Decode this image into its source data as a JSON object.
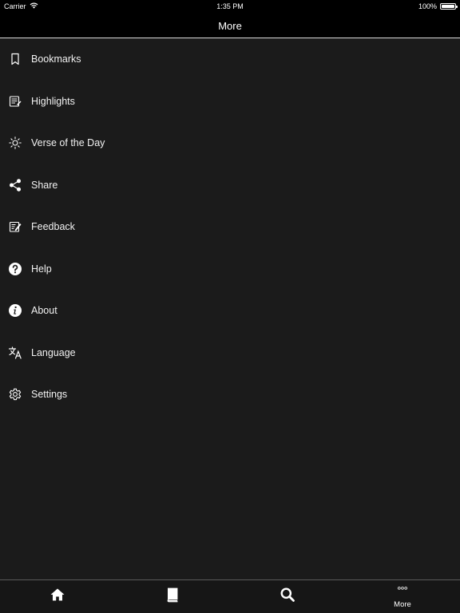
{
  "status_bar": {
    "carrier": "Carrier",
    "time": "1:35 PM",
    "battery": "100%",
    "battery_level": 1.0
  },
  "nav_bar": {
    "title": "More"
  },
  "menu": {
    "items": [
      {
        "label": "Bookmarks",
        "icon": "bookmark-icon"
      },
      {
        "label": "Highlights",
        "icon": "highlights-icon"
      },
      {
        "label": "Verse of the Day",
        "icon": "sun-icon"
      },
      {
        "label": "Share",
        "icon": "share-icon"
      },
      {
        "label": "Feedback",
        "icon": "feedback-icon"
      },
      {
        "label": "Help",
        "icon": "help-icon"
      },
      {
        "label": "About",
        "icon": "info-icon"
      },
      {
        "label": "Language",
        "icon": "translate-icon"
      },
      {
        "label": "Settings",
        "icon": "gear-icon"
      }
    ]
  },
  "tab_bar": {
    "tabs": [
      {
        "icon": "home-icon",
        "label": ""
      },
      {
        "icon": "book-icon",
        "label": ""
      },
      {
        "icon": "search-icon",
        "label": ""
      },
      {
        "icon": "more-dots-icon",
        "label": "More",
        "selected": true
      }
    ]
  },
  "colors": {
    "background": "#1b1b1b",
    "bars": "#000000",
    "text": "#ffffff"
  }
}
